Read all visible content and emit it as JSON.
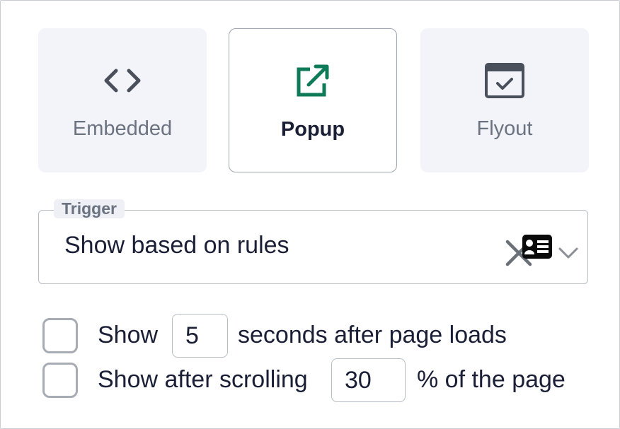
{
  "colors": {
    "accent_green": "#0e7a57",
    "card_bg": "#f3f4f9",
    "text_dark": "#1a1f36",
    "text_muted": "#6b7280",
    "icon_gray": "#4a4f5c"
  },
  "display_types": [
    {
      "label": "Embedded",
      "icon": "code-brackets-icon",
      "selected": false
    },
    {
      "label": "Popup",
      "icon": "external-link-icon",
      "selected": true
    },
    {
      "label": "Flyout",
      "icon": "window-check-icon",
      "selected": false
    }
  ],
  "trigger": {
    "legend": "Trigger",
    "value": "Show based on rules",
    "icons": [
      "clear-icon",
      "contact-card-icon",
      "chevron-down-icon"
    ]
  },
  "rules": [
    {
      "checked": false,
      "prefix": "Show",
      "value": "5",
      "suffix": "seconds after page loads"
    },
    {
      "checked": false,
      "prefix": "Show after scrolling",
      "value": "30",
      "suffix": "% of the page"
    }
  ]
}
